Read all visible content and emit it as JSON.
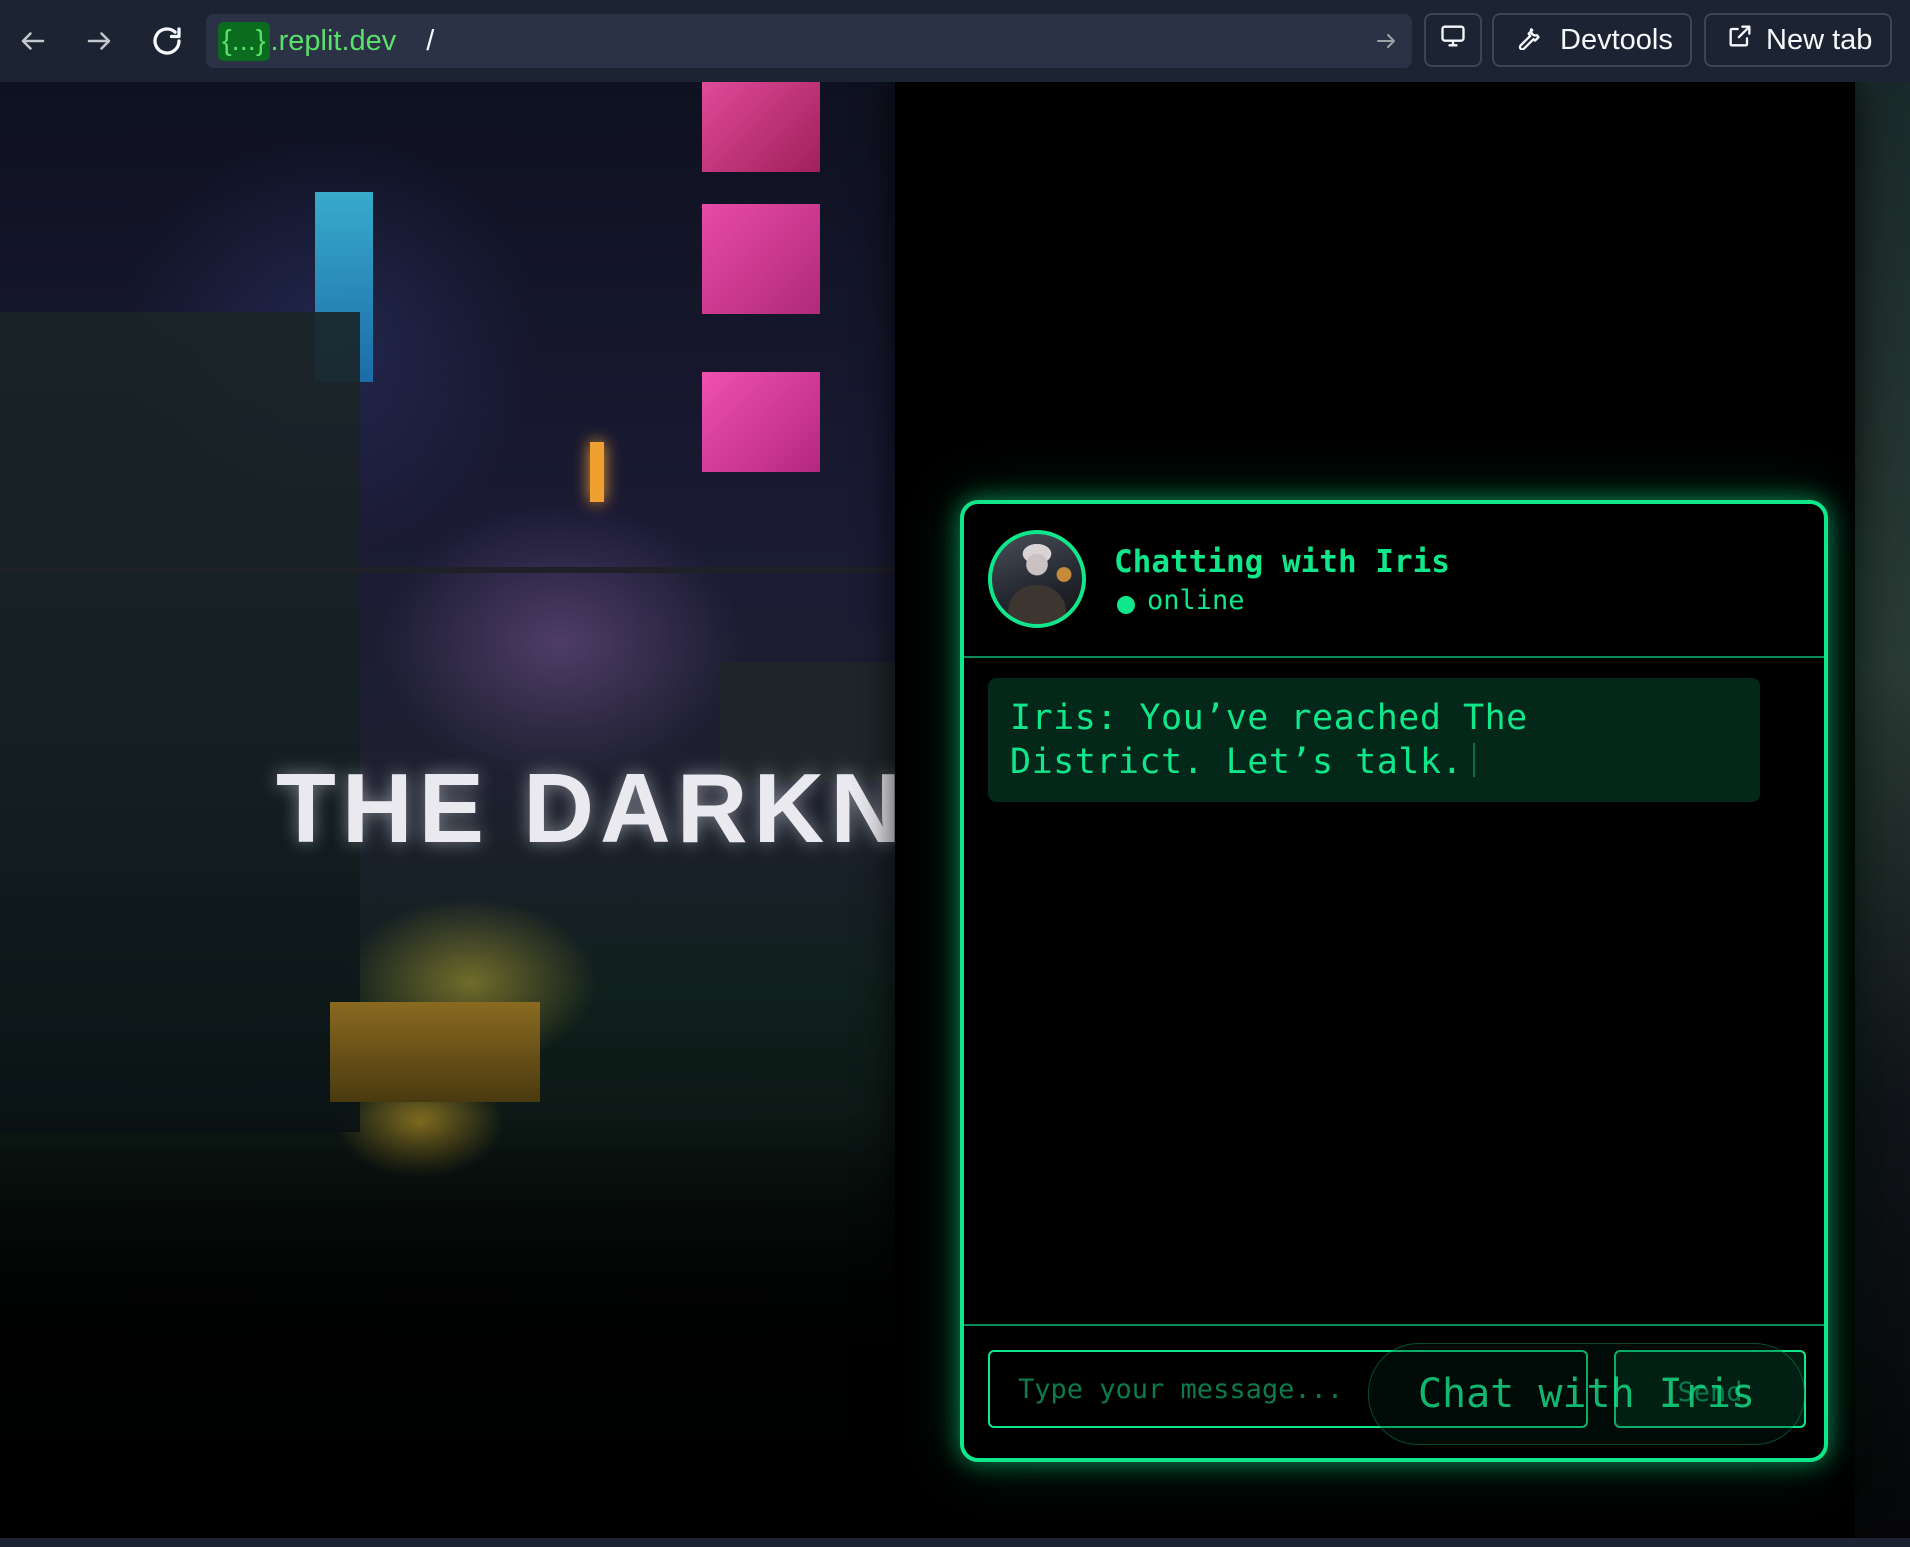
{
  "browser": {
    "url_chip": "{...}",
    "url_domain": ".replit.dev",
    "url_path": "/",
    "devtools_label": "Devtools",
    "new_tab_label": "New tab"
  },
  "hero": {
    "title": "THE DARKN"
  },
  "chat": {
    "title": "Chatting with Iris",
    "status": "online",
    "messages": [
      {
        "text": "Iris: You’ve reached The District. Let’s talk."
      }
    ],
    "input_placeholder": "Type your message...",
    "send_label": "Send",
    "floating_button": "Chat with Iris"
  },
  "colors": {
    "accent": "#10e68a",
    "message_bg": "#03281a",
    "toolbar_bg": "#1c2333",
    "url_green": "#58e06a"
  },
  "icons": [
    "back-arrow-icon",
    "forward-arrow-icon",
    "reload-icon",
    "go-arrow-icon",
    "monitor-icon",
    "wrench-icon",
    "external-link-icon",
    "status-dot-icon"
  ]
}
